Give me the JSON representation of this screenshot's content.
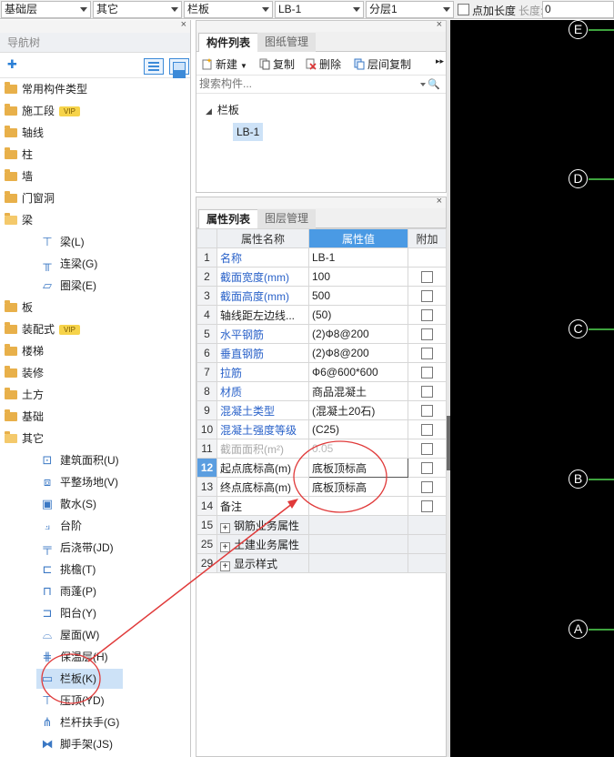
{
  "toolbar": {
    "floor": "基础层",
    "category": "其它",
    "component_type": "栏板",
    "component": "LB-1",
    "layer": "分层1",
    "point_length_label": "点加长度",
    "length_label": "长度:",
    "length_value": "0"
  },
  "nav": {
    "title": "导航树",
    "groups_top": [
      {
        "label": "常用构件类型",
        "vip": false
      },
      {
        "label": "施工段",
        "vip": true
      },
      {
        "label": "轴线",
        "vip": false
      },
      {
        "label": "柱",
        "vip": false
      },
      {
        "label": "墙",
        "vip": false
      },
      {
        "label": "门窗洞",
        "vip": false
      },
      {
        "label": "梁",
        "vip": false
      }
    ],
    "beam_children": [
      {
        "label": "梁(L)",
        "icon": "beam-icon"
      },
      {
        "label": "连梁(G)",
        "icon": "link-beam-icon"
      },
      {
        "label": "圈梁(E)",
        "icon": "ring-beam-icon"
      }
    ],
    "groups_mid": [
      {
        "label": "板",
        "vip": false
      },
      {
        "label": "装配式",
        "vip": true
      },
      {
        "label": "楼梯",
        "vip": false
      },
      {
        "label": "装修",
        "vip": false
      },
      {
        "label": "土方",
        "vip": false
      },
      {
        "label": "基础",
        "vip": false
      },
      {
        "label": "其它",
        "vip": false
      }
    ],
    "other_children": [
      {
        "label": "建筑面积(U)",
        "icon": "building-area-icon"
      },
      {
        "label": "平整场地(V)",
        "icon": "site-leveling-icon"
      },
      {
        "label": "散水(S)",
        "icon": "apron-icon"
      },
      {
        "label": "台阶",
        "icon": "step-icon"
      },
      {
        "label": "后浇带(JD)",
        "icon": "post-cast-strip-icon"
      },
      {
        "label": "挑檐(T)",
        "icon": "cornice-icon"
      },
      {
        "label": "雨蓬(P)",
        "icon": "canopy-icon"
      },
      {
        "label": "阳台(Y)",
        "icon": "balcony-icon"
      },
      {
        "label": "屋面(W)",
        "icon": "roof-icon"
      },
      {
        "label": "保温层(H)",
        "icon": "insulation-icon"
      },
      {
        "label": "栏板(K)",
        "icon": "parapet-icon"
      },
      {
        "label": "压顶(YD)",
        "icon": "coping-icon"
      },
      {
        "label": "栏杆扶手(G)",
        "icon": "railing-icon"
      },
      {
        "label": "脚手架(JS)",
        "icon": "scaffold-icon"
      }
    ],
    "vip_text": "VIP"
  },
  "components": {
    "tabs": [
      "构件列表",
      "图纸管理"
    ],
    "tools": {
      "new": "新建",
      "copy": "复制",
      "delete": "删除",
      "floor_copy": "层间复制"
    },
    "search_placeholder": "搜索构件...",
    "tree_root": "栏板",
    "tree_item": "LB-1"
  },
  "properties": {
    "tabs": [
      "属性列表",
      "图层管理"
    ],
    "headers": {
      "name": "属性名称",
      "value": "属性值",
      "extra": "附加"
    },
    "rows": [
      {
        "num": "1",
        "name": "名称",
        "value": "LB-1",
        "style": "blue",
        "checkbox": false
      },
      {
        "num": "2",
        "name": "截面宽度(mm)",
        "value": "100",
        "style": "blue",
        "checkbox": true
      },
      {
        "num": "3",
        "name": "截面高度(mm)",
        "value": "500",
        "style": "blue",
        "checkbox": true
      },
      {
        "num": "4",
        "name": "轴线距左边线...",
        "value": "(50)",
        "style": "black",
        "checkbox": true
      },
      {
        "num": "5",
        "name": "水平钢筋",
        "value": "(2)Ф8@200",
        "style": "blue",
        "checkbox": true
      },
      {
        "num": "6",
        "name": "垂直钢筋",
        "value": "(2)Ф8@200",
        "style": "blue",
        "checkbox": true
      },
      {
        "num": "7",
        "name": "拉筋",
        "value": "Ф6@600*600",
        "style": "blue",
        "checkbox": true
      },
      {
        "num": "8",
        "name": "材质",
        "value": "商品混凝土",
        "style": "blue",
        "checkbox": true
      },
      {
        "num": "9",
        "name": "混凝土类型",
        "value": "(混凝土20石)",
        "style": "blue",
        "checkbox": true
      },
      {
        "num": "10",
        "name": "混凝土强度等级",
        "value": "(C25)",
        "style": "blue",
        "checkbox": true
      },
      {
        "num": "11",
        "name": "截面面积(m²)",
        "value": "0.05",
        "style": "gray",
        "checkbox": true
      },
      {
        "num": "12",
        "name": "起点底标高(m)",
        "value": "底板顶标高",
        "style": "black",
        "checkbox": true,
        "current": true
      },
      {
        "num": "13",
        "name": "终点底标高(m)",
        "value": "底板顶标高",
        "style": "black",
        "checkbox": true
      },
      {
        "num": "14",
        "name": "备注",
        "value": "",
        "style": "black",
        "checkbox": true
      }
    ],
    "groups": [
      {
        "num": "15",
        "name": "钢筋业务属性"
      },
      {
        "num": "25",
        "name": "土建业务属性"
      },
      {
        "num": "29",
        "name": "显示样式"
      }
    ]
  },
  "canvas": {
    "axes": [
      "E",
      "D",
      "C",
      "B",
      "A"
    ],
    "background": "#000000",
    "axis_line_color": "#3ea33e",
    "annotation_color": "#e03a3a"
  }
}
